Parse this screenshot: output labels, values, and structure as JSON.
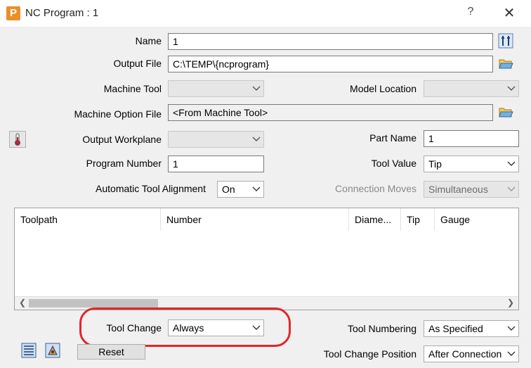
{
  "window": {
    "title": "NC Program : 1",
    "help": "?",
    "close": "✕",
    "app_icon": "P"
  },
  "fields": {
    "name": {
      "label": "Name",
      "value": "1"
    },
    "output_file": {
      "label": "Output File",
      "value": "C:\\TEMP\\{ncprogram}"
    },
    "machine_tool": {
      "label": "Machine Tool",
      "value": ""
    },
    "model_location": {
      "label": "Model Location",
      "value": ""
    },
    "machine_option_file": {
      "label": "Machine Option File",
      "value": "<From Machine Tool>"
    },
    "output_workplane": {
      "label": "Output Workplane",
      "value": ""
    },
    "part_name": {
      "label": "Part Name",
      "value": "1"
    },
    "program_number": {
      "label": "Program Number",
      "value": "1"
    },
    "tool_value": {
      "label": "Tool Value",
      "value": "Tip"
    },
    "automatic_tool_alignment": {
      "label": "Automatic Tool Alignment",
      "value": "On"
    },
    "connection_moves": {
      "label": "Connection Moves",
      "value": "Simultaneous"
    },
    "tool_change": {
      "label": "Tool Change",
      "value": "Always"
    },
    "tool_numbering": {
      "label": "Tool Numbering",
      "value": "As Specified"
    },
    "tool_change_position": {
      "label": "Tool Change Position",
      "value": "After Connection"
    }
  },
  "table": {
    "columns": [
      "Toolpath",
      "Number",
      "Diame...",
      "Tip",
      "Gauge"
    ],
    "rows": []
  },
  "buttons": {
    "reset": "Reset"
  },
  "colors": {
    "highlight": "#e2262a",
    "app_icon": "#e8902a"
  },
  "icons": {
    "name_action": "tool-wrench-icon",
    "output_file_browse": "folder-open-icon",
    "option_file_browse": "folder-open-icon",
    "thermometer": "thermometer-icon",
    "bottom_left_1": "toolpath-list-icon",
    "bottom_left_2": "toolpath-view-icon"
  }
}
